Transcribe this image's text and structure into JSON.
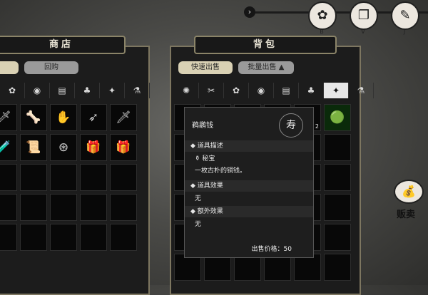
{
  "topbar": {
    "arrow_icon": "chevron-right-icon",
    "icons": [
      {
        "name": "character-icon",
        "glyph": "✿",
        "key": "B"
      },
      {
        "name": "journal-icon",
        "glyph": "❐",
        "key": "V"
      },
      {
        "name": "skills-icon",
        "glyph": "✎",
        "key": "J"
      }
    ]
  },
  "shop": {
    "title": "商店",
    "tabs": [
      {
        "label": "",
        "active": true
      },
      {
        "label": "回购",
        "active": false
      }
    ],
    "categories": [
      "✿",
      "◉",
      "▤",
      "♣",
      "✦",
      "⚗"
    ],
    "items": [
      "🗡",
      "🦴",
      "✋",
      "➶",
      "🗡",
      "🧪",
      "📜",
      "⊛",
      "🎁",
      "🎁"
    ]
  },
  "bag": {
    "title": "背包",
    "buttons": [
      {
        "label": "快速出售",
        "active": true
      },
      {
        "label": "批量出售",
        "active": false,
        "arrow": "▲"
      }
    ],
    "categories": [
      "✺",
      "✂",
      "✿",
      "◉",
      "▤",
      "♣",
      "✦",
      "⚗"
    ],
    "selected_category": 6,
    "item_counts": {
      "row0_col4": "2"
    },
    "special_item": "🟢"
  },
  "tooltip": {
    "item_name": "鹈鹕钱",
    "item_badge": "寿",
    "section_desc": "道具描述",
    "tag": "秘宝",
    "desc_text": "一枚古朴的铜钱。",
    "section_effect": "道具效果",
    "effect_text": "无",
    "section_extra": "额外效果",
    "extra_text": "无",
    "price_label": "出售价格：",
    "price_value": "50"
  },
  "sell": {
    "label": "贩卖",
    "icon": "coin-bag-icon"
  }
}
